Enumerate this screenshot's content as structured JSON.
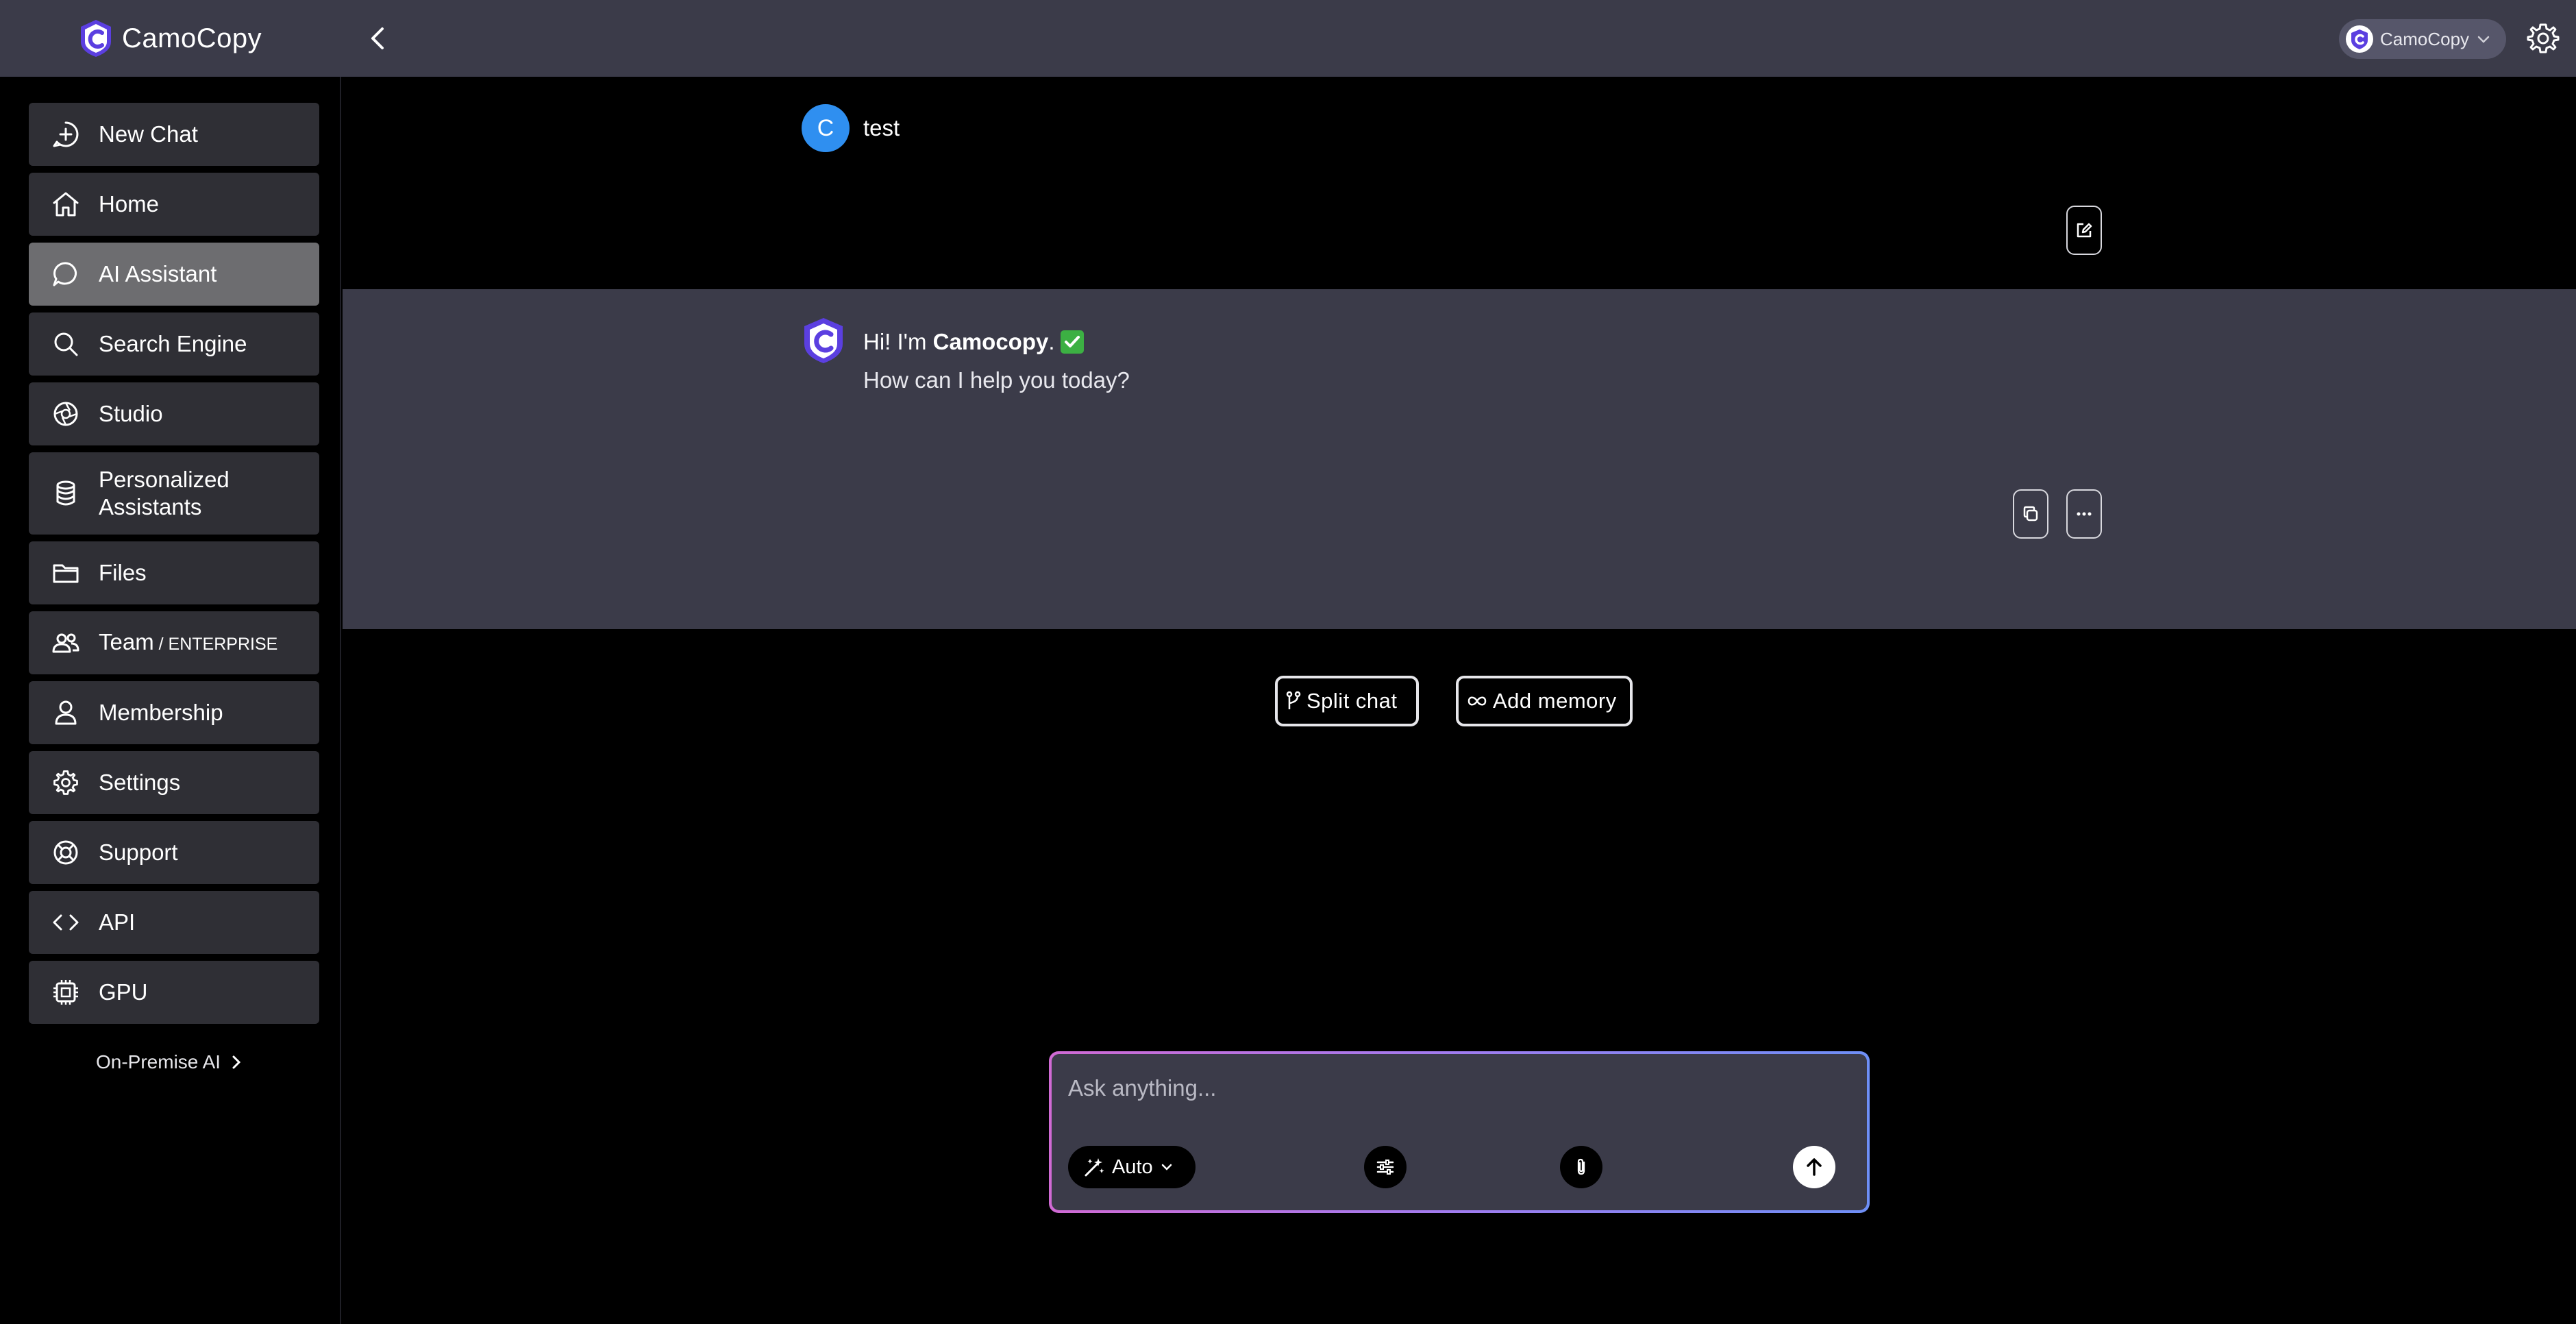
{
  "app": {
    "logo_text": "CamoCopy"
  },
  "header": {
    "account_name": "CamoCopy"
  },
  "sidebar": {
    "items": [
      {
        "label": "New Chat",
        "icon": "plus-circle-icon"
      },
      {
        "label": "Home",
        "icon": "home-icon"
      },
      {
        "label": "AI Assistant",
        "icon": "chat-bubble-icon",
        "active": true
      },
      {
        "label": "Search Engine",
        "icon": "search-icon"
      },
      {
        "label": "Studio",
        "icon": "aperture-icon"
      },
      {
        "label": "Personalized",
        "label2": "Assistants",
        "icon": "database-icon"
      },
      {
        "label": "Files",
        "icon": "folder-icon"
      },
      {
        "label": "Team",
        "suffix": " / ENTERPRISE",
        "icon": "users-icon"
      },
      {
        "label": "Membership",
        "icon": "user-icon"
      },
      {
        "label": "Settings",
        "icon": "gear-icon"
      },
      {
        "label": "Support",
        "icon": "lifebuoy-icon"
      },
      {
        "label": "API",
        "icon": "code-icon"
      },
      {
        "label": "GPU",
        "icon": "chip-icon"
      }
    ],
    "footer_link": "On-Premise AI"
  },
  "chat": {
    "user_message": {
      "avatar_letter": "C",
      "text": "test"
    },
    "bot_message": {
      "line1_prefix": "Hi! I'm ",
      "line1_brand": "Camocopy",
      "line1_suffix": ".",
      "line2": "How can I help you today?"
    },
    "actions": {
      "split": "Split chat",
      "memory": "Add memory"
    }
  },
  "composer": {
    "placeholder": "Ask anything...",
    "model": "Auto"
  },
  "colors": {
    "topbar": "#3b3b49",
    "nav_item": "#2f2f35",
    "nav_active": "#6d6d70",
    "user_avatar": "#2f8ff0",
    "brand": "#5b3fe0"
  }
}
